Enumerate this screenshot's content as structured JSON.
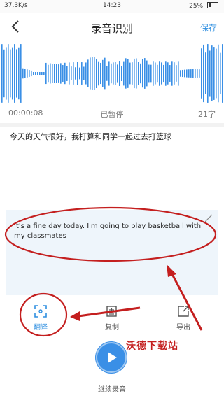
{
  "status_bar": {
    "network": "37.3K/s",
    "time": "14:23",
    "battery": "25%"
  },
  "nav": {
    "title": "录音识别",
    "save_label": "保存",
    "back_icon": "chevron-left-icon"
  },
  "recording": {
    "elapsed": "00:00:08",
    "state": "已暂停",
    "char_count": "21字"
  },
  "original_text": "今天的天气很好，我打算和同学一起过去打篮球",
  "translation": {
    "text": "It's a fine day today. I'm going to play basketball with my classmates",
    "close_icon": "close-icon"
  },
  "toolbar": {
    "translate_label": "翻译",
    "copy_label": "复制",
    "export_label": "导出"
  },
  "record_button": {
    "label": "继续录音",
    "icon": "play-icon"
  },
  "watermark": "沃德下载站",
  "colors": {
    "accent": "#2f8fe0",
    "wave": "#3a8fe6",
    "annotation": "#c41f1f"
  }
}
